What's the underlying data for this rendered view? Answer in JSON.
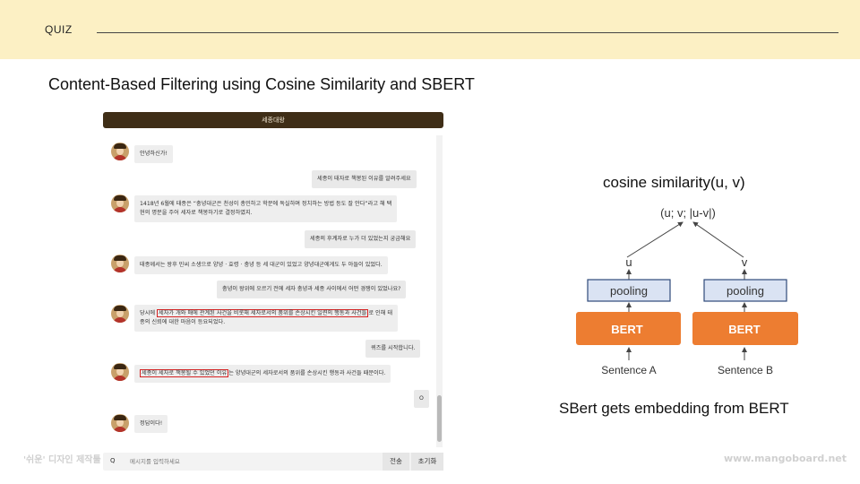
{
  "header": {
    "quiz_label": "QUIZ"
  },
  "main_title": "Content-Based Filtering using Cosine Similarity and SBERT",
  "chat": {
    "title": "세종대왕",
    "messages": [
      {
        "side": "left",
        "text": "안녕하신가!"
      },
      {
        "side": "right",
        "text": "세종이 태자로 책봉된 이유를 알려주세요"
      },
      {
        "side": "left",
        "lines": [
          "1418년 6월에 태종은 “충녕대군은 천성이 총민하고 학문에 독실하며 정치하는 방법 등도 잘 안다”라고 해 택",
          "현의 명분을 주어 세자로 책봉하기로 결정하였지."
        ]
      },
      {
        "side": "right",
        "text": "세종의 후계자로 누가 더 있었는지 궁금해요"
      },
      {
        "side": "left",
        "text": "태종께서는 왕후 민씨 소생으로 양녕 · 효령 · 충녕 등 세 대군이 있었고 양녕대군에게도 두 아들이 있었다."
      },
      {
        "side": "right",
        "text": "충녕이 왕위에 오르기 전에 세자 충녕과 세종 사이에서 어떤 경쟁이 있었나요?"
      },
      {
        "side": "left",
        "line1_pre": "당시에 ",
        "line1_hl": "세자가 개와 매에 관계된 사건을 비롯해 세자로서의 품위를 손상시킨 일련의 행동과 사건들",
        "line1_post": "로 인해 태",
        "line2": "종의 신뢰에 대한 마음이 등요되었다."
      },
      {
        "side": "right",
        "text": "퀴즈를 시작합니다."
      },
      {
        "side": "left",
        "hl": "세종이 세자로 책봉될 수 있었던 이유",
        "post": "는 양녕대군의 세자로서의 품위를 손상시킨 행동과 사건들 때문이다."
      },
      {
        "side": "right",
        "text": "O"
      },
      {
        "side": "left",
        "text": "정답이다!"
      }
    ],
    "input": {
      "prefix": "Q",
      "placeholder": "메시지를 입력하세요"
    },
    "send_label": "전송",
    "reset_label": "초기화"
  },
  "diagram": {
    "title": "cosine similarity(u, v)",
    "output_label": "(u; v; |u-v|)",
    "u_label": "u",
    "v_label": "v",
    "pooling_left": "pooling",
    "pooling_right": "pooling",
    "bert_left": "BERT",
    "bert_right": "BERT",
    "sentence_a": "Sentence A",
    "sentence_b": "Sentence B",
    "caption": "SBert gets embedding from BERT",
    "colors": {
      "bert": "#ed7d31",
      "pooling": "#dae3f3",
      "pooling_border": "#2f4a7a"
    }
  },
  "watermarks": {
    "left": "'쉬운' 디자인 제작툴",
    "right": "www.mangoboard.net"
  }
}
